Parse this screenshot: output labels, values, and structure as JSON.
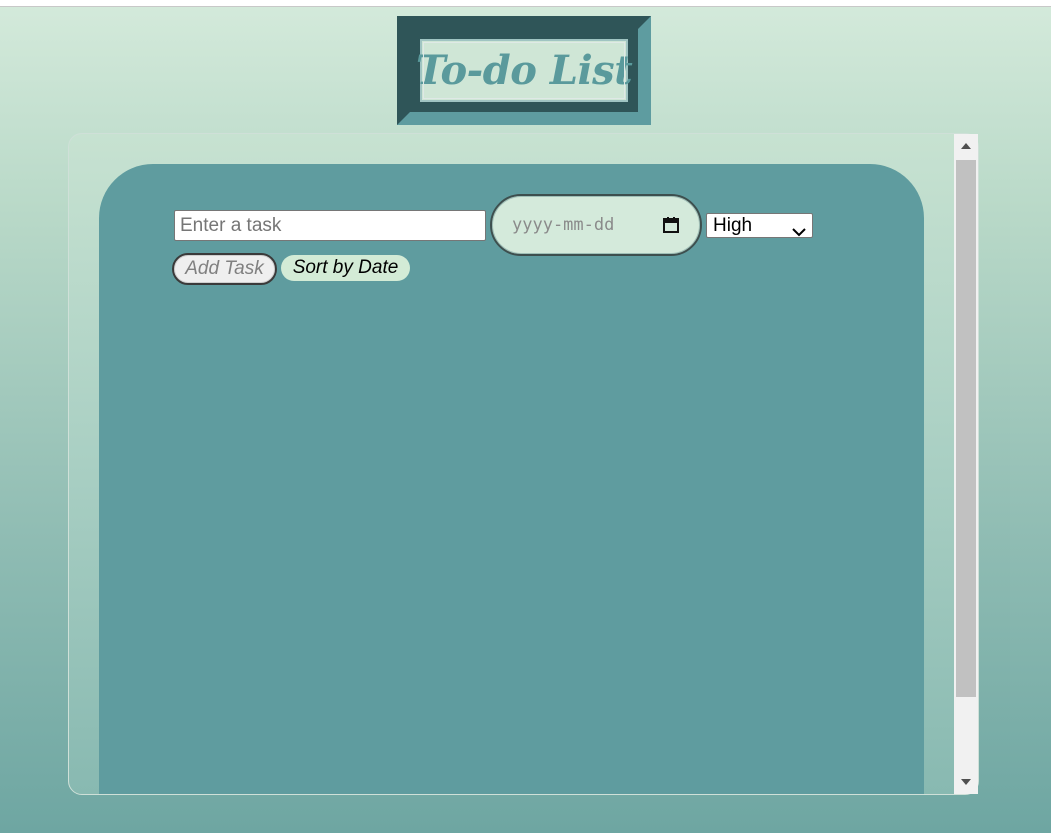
{
  "header": {
    "title": "To-do List"
  },
  "form": {
    "task_placeholder": "Enter a task",
    "date_placeholder": "yyyy-mm-dd",
    "priority_selected": "High",
    "add_label": "Add Task",
    "sort_label": "Sort by Date"
  },
  "scrollbar": {
    "position_fraction": 0.0,
    "visible_fraction": 0.85
  },
  "icons": {
    "calendar": "calendar-icon",
    "chevron": "chevron-down-icon",
    "scroll_up": "scroll-up-arrow-icon",
    "scroll_down": "scroll-down-arrow-icon"
  },
  "colors": {
    "panel": "#5f9c9f",
    "title_text": "#5a9a9c",
    "frame_dark": "#2f5558",
    "sort_button_bg": "#d3ebd6"
  }
}
